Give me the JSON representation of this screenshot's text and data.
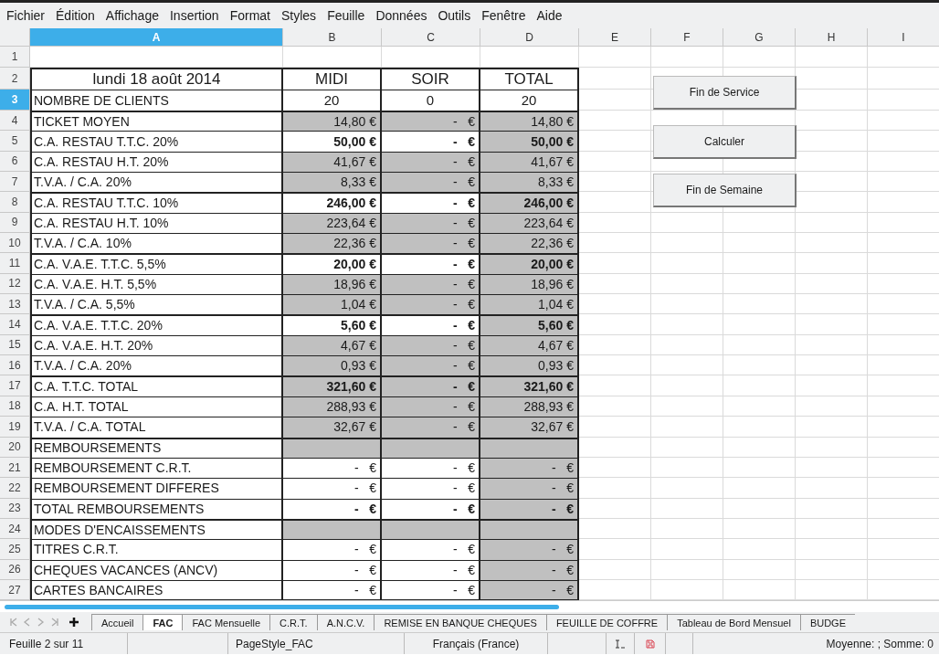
{
  "menu": [
    "Fichier",
    "Édition",
    "Affichage",
    "Insertion",
    "Format",
    "Styles",
    "Feuille",
    "Données",
    "Outils",
    "Fenêtre",
    "Aide"
  ],
  "columns": [
    {
      "label": "A",
      "selected": true
    },
    {
      "label": "B",
      "selected": false
    },
    {
      "label": "C",
      "selected": false
    },
    {
      "label": "D",
      "selected": false
    },
    {
      "label": "E",
      "selected": false
    },
    {
      "label": "F",
      "selected": false
    },
    {
      "label": "G",
      "selected": false
    },
    {
      "label": "H",
      "selected": false
    },
    {
      "label": "I",
      "selected": false
    }
  ],
  "rows": [
    {
      "num": "1",
      "selected": false,
      "kind": "blank",
      "section_start": false,
      "cells": []
    },
    {
      "num": "2",
      "selected": false,
      "kind": "title",
      "section_start": true,
      "cells": [
        {
          "text": "lundi 18 août 2014",
          "shaded": false,
          "bold": false
        },
        {
          "text": "MIDI",
          "shaded": false,
          "bold": false
        },
        {
          "text": "SOIR",
          "shaded": false,
          "bold": false
        },
        {
          "text": "TOTAL",
          "shaded": false,
          "bold": false
        }
      ]
    },
    {
      "num": "3",
      "selected": true,
      "kind": "count",
      "section_start": false,
      "cells": [
        {
          "text": "NOMBRE DE CLIENTS",
          "shaded": false,
          "bold": false
        },
        {
          "text": "20",
          "shaded": false,
          "bold": false
        },
        {
          "text": "0",
          "shaded": false,
          "bold": false
        },
        {
          "text": "20",
          "shaded": false,
          "bold": false
        }
      ]
    },
    {
      "num": "4",
      "selected": false,
      "kind": "data",
      "section_start": true,
      "cells": [
        {
          "text": "TICKET MOYEN",
          "shaded": false,
          "bold": false
        },
        {
          "text": "14,80 €",
          "shaded": true,
          "bold": false
        },
        {
          "text": "-   €",
          "shaded": true,
          "bold": false
        },
        {
          "text": "14,80 €",
          "shaded": true,
          "bold": false
        }
      ]
    },
    {
      "num": "5",
      "selected": false,
      "kind": "data",
      "section_start": false,
      "cells": [
        {
          "text": "C.A. RESTAU T.T.C. 20%",
          "shaded": false,
          "bold": false
        },
        {
          "text": "50,00 €",
          "shaded": false,
          "bold": true
        },
        {
          "text": "-   €",
          "shaded": false,
          "bold": true
        },
        {
          "text": "50,00 €",
          "shaded": true,
          "bold": true
        }
      ]
    },
    {
      "num": "6",
      "selected": false,
      "kind": "data",
      "section_start": false,
      "cells": [
        {
          "text": "C.A. RESTAU H.T. 20%",
          "shaded": false,
          "bold": false
        },
        {
          "text": "41,67 €",
          "shaded": true,
          "bold": false
        },
        {
          "text": "-   €",
          "shaded": true,
          "bold": false
        },
        {
          "text": "41,67 €",
          "shaded": true,
          "bold": false
        }
      ]
    },
    {
      "num": "7",
      "selected": false,
      "kind": "data",
      "section_start": false,
      "cells": [
        {
          "text": "T.V.A. / C.A. 20%",
          "shaded": false,
          "bold": false
        },
        {
          "text": "8,33 €",
          "shaded": true,
          "bold": false
        },
        {
          "text": "-   €",
          "shaded": true,
          "bold": false
        },
        {
          "text": "8,33 €",
          "shaded": true,
          "bold": false
        }
      ]
    },
    {
      "num": "8",
      "selected": false,
      "kind": "data",
      "section_start": true,
      "cells": [
        {
          "text": "C.A. RESTAU T.T.C. 10%",
          "shaded": false,
          "bold": false
        },
        {
          "text": "246,00 €",
          "shaded": false,
          "bold": true
        },
        {
          "text": "-   €",
          "shaded": false,
          "bold": true
        },
        {
          "text": "246,00 €",
          "shaded": true,
          "bold": true
        }
      ]
    },
    {
      "num": "9",
      "selected": false,
      "kind": "data",
      "section_start": false,
      "cells": [
        {
          "text": "C.A. RESTAU H.T. 10%",
          "shaded": false,
          "bold": false
        },
        {
          "text": "223,64 €",
          "shaded": true,
          "bold": false
        },
        {
          "text": "-   €",
          "shaded": true,
          "bold": false
        },
        {
          "text": "223,64 €",
          "shaded": true,
          "bold": false
        }
      ]
    },
    {
      "num": "10",
      "selected": false,
      "kind": "data",
      "section_start": false,
      "cells": [
        {
          "text": "T.V.A. / C.A. 10%",
          "shaded": false,
          "bold": false
        },
        {
          "text": "22,36 €",
          "shaded": true,
          "bold": false
        },
        {
          "text": "-   €",
          "shaded": true,
          "bold": false
        },
        {
          "text": "22,36 €",
          "shaded": true,
          "bold": false
        }
      ]
    },
    {
      "num": "11",
      "selected": false,
      "kind": "data",
      "section_start": true,
      "cells": [
        {
          "text": "C.A. V.A.E. T.T.C. 5,5%",
          "shaded": false,
          "bold": false
        },
        {
          "text": "20,00 €",
          "shaded": false,
          "bold": true
        },
        {
          "text": "-   €",
          "shaded": false,
          "bold": true
        },
        {
          "text": "20,00 €",
          "shaded": true,
          "bold": true
        }
      ]
    },
    {
      "num": "12",
      "selected": false,
      "kind": "data",
      "section_start": false,
      "cells": [
        {
          "text": "C.A. V.A.E. H.T. 5,5%",
          "shaded": false,
          "bold": false
        },
        {
          "text": "18,96 €",
          "shaded": true,
          "bold": false
        },
        {
          "text": "-   €",
          "shaded": true,
          "bold": false
        },
        {
          "text": "18,96 €",
          "shaded": true,
          "bold": false
        }
      ]
    },
    {
      "num": "13",
      "selected": false,
      "kind": "data",
      "section_start": false,
      "cells": [
        {
          "text": "T.V.A. / C.A. 5,5%",
          "shaded": false,
          "bold": false
        },
        {
          "text": "1,04 €",
          "shaded": true,
          "bold": false
        },
        {
          "text": "-   €",
          "shaded": true,
          "bold": false
        },
        {
          "text": "1,04 €",
          "shaded": true,
          "bold": false
        }
      ]
    },
    {
      "num": "14",
      "selected": false,
      "kind": "data",
      "section_start": true,
      "cells": [
        {
          "text": "C.A. V.A.E. T.T.C. 20%",
          "shaded": false,
          "bold": false
        },
        {
          "text": "5,60 €",
          "shaded": false,
          "bold": true
        },
        {
          "text": "-   €",
          "shaded": false,
          "bold": true
        },
        {
          "text": "5,60 €",
          "shaded": true,
          "bold": true
        }
      ]
    },
    {
      "num": "15",
      "selected": false,
      "kind": "data",
      "section_start": false,
      "cells": [
        {
          "text": "C.A. V.A.E. H.T. 20%",
          "shaded": false,
          "bold": false
        },
        {
          "text": "4,67 €",
          "shaded": true,
          "bold": false
        },
        {
          "text": "-   €",
          "shaded": true,
          "bold": false
        },
        {
          "text": "4,67 €",
          "shaded": true,
          "bold": false
        }
      ]
    },
    {
      "num": "16",
      "selected": false,
      "kind": "data",
      "section_start": false,
      "cells": [
        {
          "text": "T.V.A. / C.A. 20%",
          "shaded": false,
          "bold": false
        },
        {
          "text": "0,93 €",
          "shaded": true,
          "bold": false
        },
        {
          "text": "-   €",
          "shaded": true,
          "bold": false
        },
        {
          "text": "0,93 €",
          "shaded": true,
          "bold": false
        }
      ]
    },
    {
      "num": "17",
      "selected": false,
      "kind": "data",
      "section_start": true,
      "cells": [
        {
          "text": "C.A. T.T.C. TOTAL",
          "shaded": false,
          "bold": false
        },
        {
          "text": "321,60 €",
          "shaded": true,
          "bold": true
        },
        {
          "text": "-   €",
          "shaded": true,
          "bold": true
        },
        {
          "text": "321,60 €",
          "shaded": true,
          "bold": true
        }
      ]
    },
    {
      "num": "18",
      "selected": false,
      "kind": "data",
      "section_start": false,
      "cells": [
        {
          "text": "C.A. H.T. TOTAL",
          "shaded": false,
          "bold": false
        },
        {
          "text": "288,93 €",
          "shaded": true,
          "bold": false
        },
        {
          "text": "-   €",
          "shaded": true,
          "bold": false
        },
        {
          "text": "288,93 €",
          "shaded": true,
          "bold": false
        }
      ]
    },
    {
      "num": "19",
      "selected": false,
      "kind": "data",
      "section_start": false,
      "cells": [
        {
          "text": "T.V.A. / C.A. TOTAL",
          "shaded": false,
          "bold": false
        },
        {
          "text": "32,67 €",
          "shaded": true,
          "bold": false
        },
        {
          "text": "-   €",
          "shaded": true,
          "bold": false
        },
        {
          "text": "32,67 €",
          "shaded": true,
          "bold": false
        }
      ]
    },
    {
      "num": "20",
      "selected": false,
      "kind": "data",
      "section_start": true,
      "cells": [
        {
          "text": "REMBOURSEMENTS",
          "shaded": false,
          "bold": false
        },
        {
          "shaded": true
        },
        {
          "shaded": true
        },
        {
          "shaded": true
        }
      ]
    },
    {
      "num": "21",
      "selected": false,
      "kind": "data",
      "section_start": false,
      "cells": [
        {
          "text": "REMBOURSEMENT C.R.T.",
          "shaded": false,
          "bold": false
        },
        {
          "text": "-   €",
          "shaded": false,
          "bold": false
        },
        {
          "text": "-   €",
          "shaded": false,
          "bold": false
        },
        {
          "text": "-   €",
          "shaded": true,
          "bold": false
        }
      ]
    },
    {
      "num": "22",
      "selected": false,
      "kind": "data",
      "section_start": false,
      "cells": [
        {
          "text": "REMBOURSEMENT DIFFERES",
          "shaded": false,
          "bold": false
        },
        {
          "text": "-   €",
          "shaded": false,
          "bold": false
        },
        {
          "text": "-   €",
          "shaded": false,
          "bold": false
        },
        {
          "text": "-   €",
          "shaded": true,
          "bold": false
        }
      ]
    },
    {
      "num": "23",
      "selected": false,
      "kind": "data",
      "section_start": false,
      "cells": [
        {
          "text": "TOTAL REMBOURSEMENTS",
          "shaded": false,
          "bold": false
        },
        {
          "text": "-   €",
          "shaded": false,
          "bold": true
        },
        {
          "text": "-   €",
          "shaded": false,
          "bold": true
        },
        {
          "text": "-   €",
          "shaded": true,
          "bold": true
        }
      ]
    },
    {
      "num": "24",
      "selected": false,
      "kind": "data",
      "section_start": true,
      "cells": [
        {
          "text": "MODES D'ENCAISSEMENTS",
          "shaded": false,
          "bold": false
        },
        {
          "shaded": true
        },
        {
          "shaded": true
        },
        {
          "shaded": true
        }
      ]
    },
    {
      "num": "25",
      "selected": false,
      "kind": "data",
      "section_start": false,
      "cells": [
        {
          "text": "TITRES C.R.T.",
          "shaded": false,
          "bold": false
        },
        {
          "text": "-   €",
          "shaded": false,
          "bold": false
        },
        {
          "text": "-   €",
          "shaded": false,
          "bold": false
        },
        {
          "text": "-   €",
          "shaded": true,
          "bold": false
        }
      ]
    },
    {
      "num": "26",
      "selected": false,
      "kind": "data",
      "section_start": false,
      "cells": [
        {
          "text": "CHEQUES VACANCES (ANCV)",
          "shaded": false,
          "bold": false
        },
        {
          "text": "-   €",
          "shaded": false,
          "bold": false
        },
        {
          "text": "-   €",
          "shaded": false,
          "bold": false
        },
        {
          "text": "-   €",
          "shaded": true,
          "bold": false
        }
      ]
    },
    {
      "num": "27",
      "selected": false,
      "kind": "data",
      "section_start": false,
      "cells": [
        {
          "text": "CARTES BANCAIRES",
          "shaded": false,
          "bold": false
        },
        {
          "text": "-   €",
          "shaded": false,
          "bold": false
        },
        {
          "text": "-   €",
          "shaded": false,
          "bold": false
        },
        {
          "text": "-   €",
          "shaded": true,
          "bold": false
        }
      ]
    }
  ],
  "buttons": [
    "Fin de Service",
    "Calculer",
    "Fin de Semaine"
  ],
  "sheet_tabs": [
    {
      "label": "Accueil",
      "selected": false
    },
    {
      "label": "FAC",
      "selected": true
    },
    {
      "label": "FAC Mensuelle",
      "selected": false
    },
    {
      "label": "C.R.T.",
      "selected": false
    },
    {
      "label": "A.N.C.V.",
      "selected": false
    },
    {
      "label": "REMISE EN BANQUE CHEQUES",
      "selected": false
    },
    {
      "label": "FEUILLE DE COFFRE",
      "selected": false
    },
    {
      "label": "Tableau de Bord Mensuel",
      "selected": false
    },
    {
      "label": "BUDGE",
      "selected": false
    }
  ],
  "status_bar": {
    "sheet": "Feuille 2 sur 11",
    "page_style": "PageStyle_FAC",
    "language": "Français (France)",
    "summary": "Moyenne: ; Somme: 0"
  }
}
